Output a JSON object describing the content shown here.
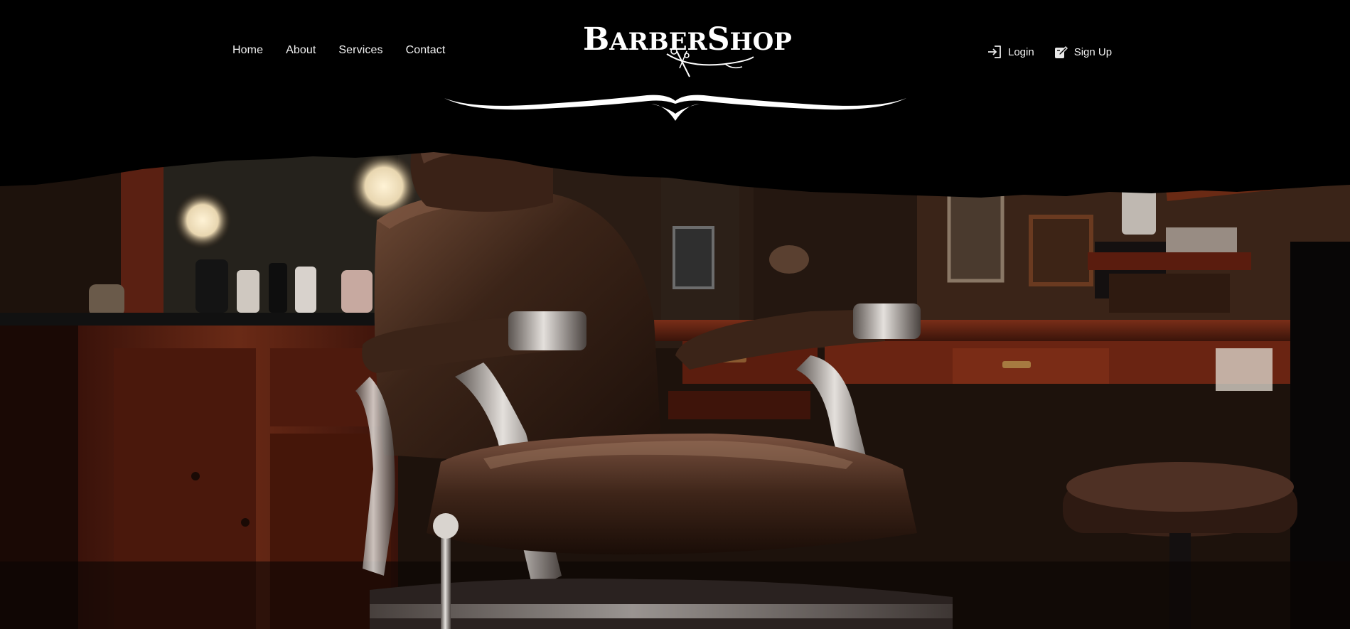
{
  "nav": {
    "links": [
      {
        "label": "Home"
      },
      {
        "label": "About"
      },
      {
        "label": "Services"
      },
      {
        "label": "Contact"
      }
    ]
  },
  "brand": {
    "logo_text": "BarberShop",
    "logo_letters": {
      "b": "B",
      "arber": "ARBER",
      "s": "S",
      "hop": "HOP"
    }
  },
  "auth": {
    "login_label": "Login",
    "login_icon": "login-arrow-icon",
    "signup_label": "Sign Up",
    "signup_icon": "edit-document-icon"
  },
  "hero": {
    "image_alt": "Vintage leather barber chair in a dimly lit barbershop"
  },
  "colors": {
    "background": "#000000",
    "text": "#f2f2f2",
    "leather": "#3b2418",
    "wood": "#5a2413",
    "chrome": "#c9c6c2"
  }
}
